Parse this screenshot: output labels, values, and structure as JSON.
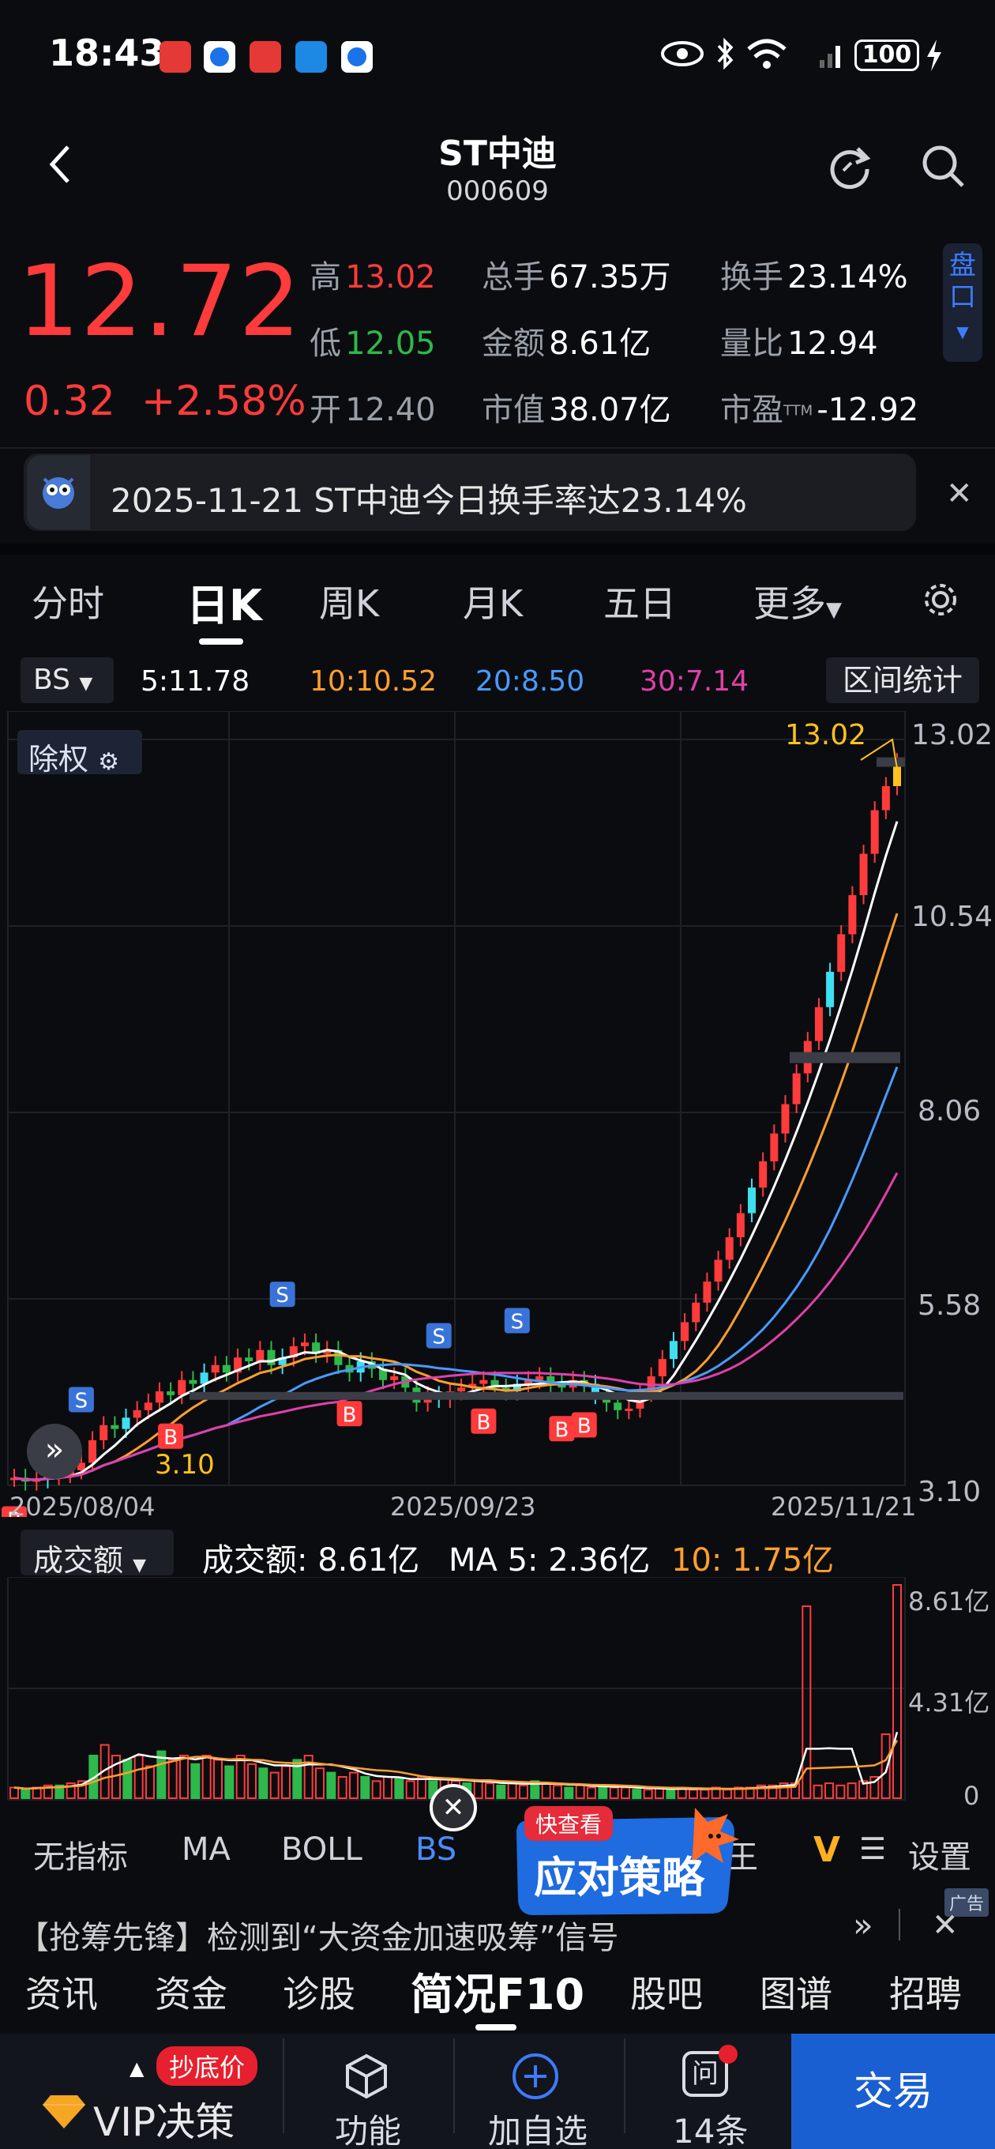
{
  "status_bar": {
    "time": "18:43",
    "battery": "100"
  },
  "header": {
    "title": "ST中迪",
    "code": "000609"
  },
  "quote": {
    "price": "12.72",
    "change": "0.32",
    "change_pct": "+2.58%",
    "high_label": "高",
    "high": "13.02",
    "low_label": "低",
    "low": "12.05",
    "open_label": "开",
    "open": "12.40",
    "volume_label": "总手",
    "volume": "67.35万",
    "amount_label": "金额",
    "amount": "8.61亿",
    "mktcap_label": "市值",
    "mktcap": "38.07亿",
    "turnover_label": "换手",
    "turnover": "23.14%",
    "vol_ratio_label": "量比",
    "vol_ratio": "12.94",
    "pe_label": "市盈",
    "pe_sup": "TTM",
    "pe": "-12.92",
    "pankou": "盘口"
  },
  "news": {
    "text": "2025-11-21 ST中迪今日换手率达23.14%"
  },
  "tabs": [
    "分时",
    "日K",
    "周K",
    "月K",
    "五日",
    "更多"
  ],
  "ma_row": {
    "selector": "BS",
    "ma5": "5:11.78",
    "ma10": "10:10.52",
    "ma20": "20:8.50",
    "ma30": "30:7.14",
    "range_button": "区间统计"
  },
  "chart_colors": {
    "up": "#ff3b3b",
    "down": "#2fb84b",
    "ma5": "#ffffff",
    "ma10": "#ff9f2e",
    "ma20": "#4a9aff",
    "ma30": "#e040a8",
    "doji": "#ffc21a",
    "cyan": "#3ee0f0"
  },
  "chart_data": {
    "type": "candlestick",
    "chuquan_label": "除权",
    "y_ticks": [
      "13.02",
      "10.54",
      "8.06",
      "5.58",
      "3.10"
    ],
    "ylim": [
      3.1,
      13.02
    ],
    "x_ticks": [
      "2025/08/04",
      "2025/09/23",
      "2025/11/21"
    ],
    "high_marker": "13.02",
    "low_marker": "3.10",
    "signals": {
      "buy_label": "B",
      "sell_label": "S"
    },
    "recent_closes": [
      4.12,
      4.33,
      4.55,
      4.78,
      5.02,
      5.27,
      5.53,
      5.81,
      6.1,
      6.4,
      6.72,
      7.06,
      7.41,
      7.78,
      8.17,
      8.58,
      9.01,
      9.46,
      9.93,
      10.43,
      10.95,
      11.5,
      12.08,
      12.4,
      12.72
    ]
  },
  "volume_panel": {
    "selector": "成交额",
    "amount": "成交额: 8.61亿",
    "ma5": "MA 5: 2.36亿",
    "ma10": "10: 1.75亿",
    "y_ticks": [
      "8.61亿",
      "4.31亿",
      "0"
    ]
  },
  "indicator_tabs": [
    "无指标",
    "MA",
    "BOLL",
    "BS",
    "王",
    "设置"
  ],
  "promo": {
    "tag": "快查看",
    "text": "应对策略"
  },
  "ad": {
    "text": "【抢筹先锋】检测到“大资金加速吸筹”信号",
    "tag": "广告"
  },
  "bottom_tabs": [
    "资讯",
    "资金",
    "诊股",
    "简况F10",
    "股吧",
    "图谱",
    "招聘"
  ],
  "bottom_bar": {
    "vip_badge": "抄底价",
    "vip_label": "VIP决策",
    "func_label": "功能",
    "add_label": "加自选",
    "ask_label": "14条",
    "trade_label": "交易"
  }
}
